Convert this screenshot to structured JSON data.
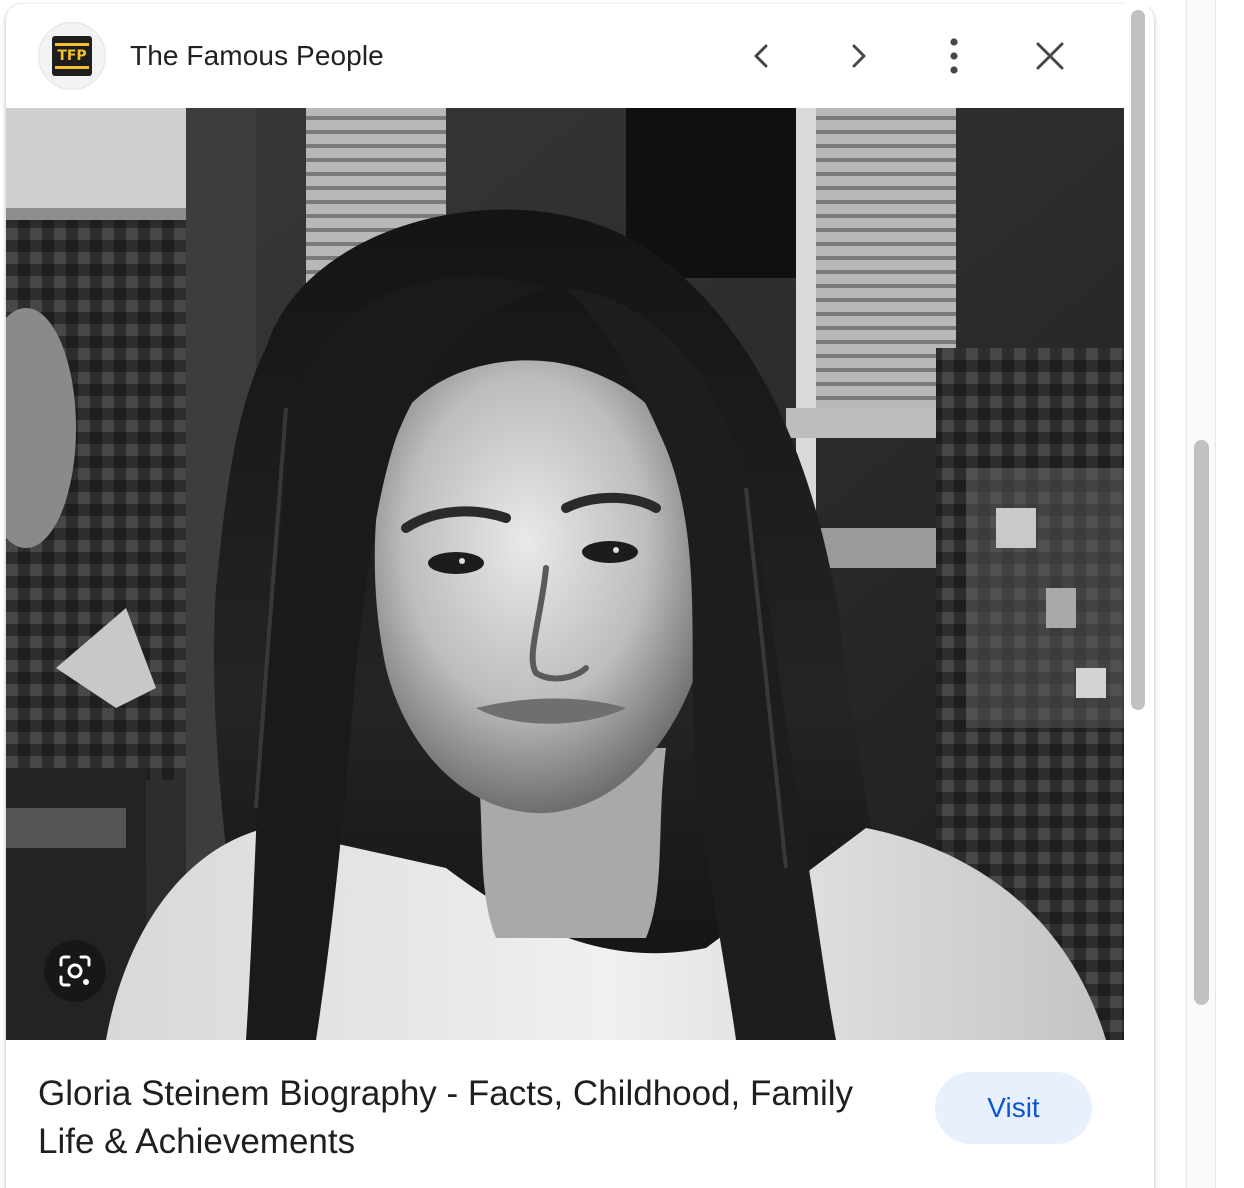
{
  "header": {
    "site_name": "The Famous People",
    "logo_text": "TFP",
    "prev_icon": "chevron-left-icon",
    "next_icon": "chevron-right-icon",
    "more_icon": "more-vert-icon",
    "close_icon": "close-icon"
  },
  "image": {
    "lens_icon": "google-lens-icon"
  },
  "result": {
    "title": "Gloria Steinem Biography - Facts, Childhood, Family Life & Achievements",
    "visit_label": "Visit"
  },
  "colors": {
    "visit_bg": "#e8f0fe",
    "visit_text": "#0b57d0",
    "logo_accent": "#f3c12b"
  }
}
